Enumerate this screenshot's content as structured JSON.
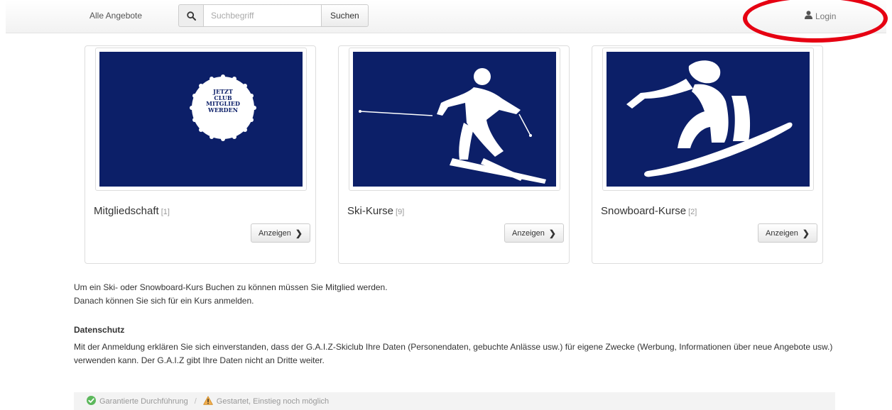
{
  "nav": {
    "all_offers": "Alle Angebote",
    "search_placeholder": "Suchbegriff",
    "search_button": "Suchen",
    "login": "Login"
  },
  "badge": {
    "line1": "JETZT",
    "line2": "CLUB",
    "line3": "MITGLIED",
    "line4": "WERDEN"
  },
  "cards": [
    {
      "title": "Mitgliedschaft",
      "count": "[1]",
      "button": "Anzeigen",
      "icon": "membership-badge"
    },
    {
      "title": "Ski-Kurse",
      "count": "[9]",
      "button": "Anzeigen",
      "icon": "skier"
    },
    {
      "title": "Snowboard-Kurse",
      "count": "[2]",
      "button": "Anzeigen",
      "icon": "snowboarder"
    }
  ],
  "info": {
    "line1": "Um ein Ski- oder Snowboard-Kurs Buchen zu können müssen Sie Mitglied werden.",
    "line2": "Danach können Sie sich für ein Kurs anmelden."
  },
  "privacy": {
    "title": "Datenschutz",
    "text": "Mit der Anmeldung erklären Sie sich einverstanden, dass der G.A.I.Z-Skiclub Ihre Daten (Personendaten, gebuchte Anlässe usw.) für eigene Zwecke (Werbung, Informationen über neue Angebote usw.) verwenden kann. Der G.A.I.Z gibt Ihre Daten nicht an Dritte weiter."
  },
  "legend": {
    "guaranteed": "Garantierte Durchführung",
    "separator": "/",
    "started": "Gestartet, Einstieg noch möglich"
  },
  "colors": {
    "card_image_bg": "#0c1f68",
    "annotation": "#e60012",
    "guaranteed_icon": "#5cb85c",
    "warning_icon": "#f0ad4e"
  }
}
